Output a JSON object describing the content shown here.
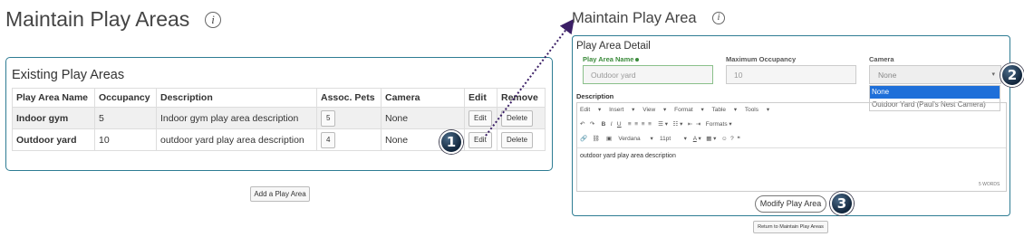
{
  "left": {
    "title": "Maintain Play Areas",
    "info_icon": "i",
    "panel_title": "Existing Play Areas",
    "columns": [
      "Play Area Name",
      "Occupancy",
      "Description",
      "Assoc. Pets",
      "Camera",
      "Edit",
      "Remove"
    ],
    "rows": [
      {
        "name": "Indoor gym",
        "occupancy": "5",
        "description": "Indoor gym play area description",
        "pets": "5",
        "camera": "None",
        "edit": "Edit",
        "remove": "Delete"
      },
      {
        "name": "Outdoor yard",
        "occupancy": "10",
        "description": "outdoor yard play area description",
        "pets": "4",
        "camera": "None",
        "edit": "Edit",
        "remove": "Delete"
      }
    ],
    "add_button": "Add a Play Area"
  },
  "right": {
    "title": "Maintain Play Area",
    "info_icon": "i",
    "detail_title": "Play Area Detail",
    "name_label": "Play Area Name",
    "name_value": "Outdoor yard",
    "max_label": "Maximum Occupancy",
    "max_value": "10",
    "camera_label": "Camera",
    "camera_value": "None",
    "camera_options": [
      "None",
      "Outdoor Yard (Paul's Nest Camera)"
    ],
    "description_label": "Description",
    "editor_menu": [
      "Edit",
      "Insert",
      "View",
      "Format",
      "Table",
      "Tools"
    ],
    "editor_font": "Verdana",
    "editor_size": "11pt",
    "editor_formats": "Formats",
    "editor_content": "outdoor yard play area description",
    "editor_wordcount": "5 WORDS",
    "modify_button": "Modify Play Area",
    "return_button": "Return to Maintain Play Areas"
  },
  "callouts": [
    "1",
    "2",
    "3"
  ],
  "colors": {
    "panel_border": "#2e7c93",
    "required_green": "#3a8a3a",
    "dropdown_selected": "#1e6fd9",
    "callout": "#1c344e"
  }
}
